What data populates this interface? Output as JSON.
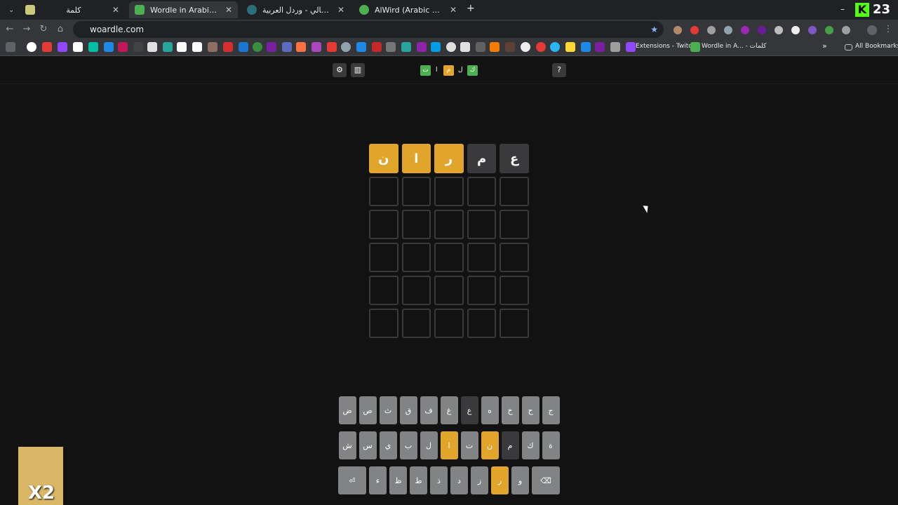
{
  "browser": {
    "tabs": [
      {
        "title": "كلمة",
        "active": false
      },
      {
        "title": "Wordle in Arabic - كلمات",
        "active": true
      },
      {
        "title": "كلمالي - وردل العربية - naly.com",
        "active": false
      },
      {
        "title": "AlWird (Arabic Wordle) - الورد",
        "active": false
      }
    ],
    "new_tab": "+",
    "url": "woardle.com",
    "bookmarks": {
      "extensions_twitch": "Extensions - Twitch",
      "wordle_in_a": "Wordle in A... - كلمات",
      "all_bookmarks": "All Bookmarks"
    },
    "window": {
      "minimize": "–",
      "counter": "23"
    }
  },
  "game": {
    "header": {
      "settings_icon": "gear-icon",
      "stats_icon": "bar-chart-icon",
      "help_label": "?",
      "logo": [
        {
          "char": "ت",
          "state": "correct",
          "color": "#4caf50"
        },
        {
          "char": "ا",
          "state": "plain"
        },
        {
          "char": "م",
          "state": "present",
          "color": "#e2a52b"
        },
        {
          "char": "ل",
          "state": "plain"
        },
        {
          "char": "ك",
          "state": "correct",
          "color": "#4caf50"
        }
      ]
    },
    "board": {
      "rows": [
        [
          {
            "letter": "ن",
            "state": "present"
          },
          {
            "letter": "ا",
            "state": "present"
          },
          {
            "letter": "ر",
            "state": "present"
          },
          {
            "letter": "م",
            "state": "absent"
          },
          {
            "letter": "ع",
            "state": "absent"
          }
        ],
        [
          {
            "letter": "",
            "state": "empty"
          },
          {
            "letter": "",
            "state": "empty"
          },
          {
            "letter": "",
            "state": "empty"
          },
          {
            "letter": "",
            "state": "empty"
          },
          {
            "letter": "",
            "state": "empty"
          }
        ],
        [
          {
            "letter": "",
            "state": "empty"
          },
          {
            "letter": "",
            "state": "empty"
          },
          {
            "letter": "",
            "state": "empty"
          },
          {
            "letter": "",
            "state": "empty"
          },
          {
            "letter": "",
            "state": "empty"
          }
        ],
        [
          {
            "letter": "",
            "state": "empty"
          },
          {
            "letter": "",
            "state": "empty"
          },
          {
            "letter": "",
            "state": "empty"
          },
          {
            "letter": "",
            "state": "empty"
          },
          {
            "letter": "",
            "state": "empty"
          }
        ],
        [
          {
            "letter": "",
            "state": "empty"
          },
          {
            "letter": "",
            "state": "empty"
          },
          {
            "letter": "",
            "state": "empty"
          },
          {
            "letter": "",
            "state": "empty"
          },
          {
            "letter": "",
            "state": "empty"
          }
        ],
        [
          {
            "letter": "",
            "state": "empty"
          },
          {
            "letter": "",
            "state": "empty"
          },
          {
            "letter": "",
            "state": "empty"
          },
          {
            "letter": "",
            "state": "empty"
          },
          {
            "letter": "",
            "state": "empty"
          }
        ]
      ]
    },
    "keyboard": {
      "rows": [
        [
          {
            "k": "ض",
            "s": "normal"
          },
          {
            "k": "ص",
            "s": "normal"
          },
          {
            "k": "ث",
            "s": "normal"
          },
          {
            "k": "ق",
            "s": "normal"
          },
          {
            "k": "ف",
            "s": "normal"
          },
          {
            "k": "غ",
            "s": "normal"
          },
          {
            "k": "ع",
            "s": "absent"
          },
          {
            "k": "ه",
            "s": "normal"
          },
          {
            "k": "خ",
            "s": "normal"
          },
          {
            "k": "ح",
            "s": "normal"
          },
          {
            "k": "ج",
            "s": "normal"
          }
        ],
        [
          {
            "k": "ش",
            "s": "normal"
          },
          {
            "k": "س",
            "s": "normal"
          },
          {
            "k": "ي",
            "s": "normal"
          },
          {
            "k": "ب",
            "s": "normal"
          },
          {
            "k": "ل",
            "s": "normal"
          },
          {
            "k": "ا",
            "s": "present"
          },
          {
            "k": "ت",
            "s": "normal"
          },
          {
            "k": "ن",
            "s": "present"
          },
          {
            "k": "م",
            "s": "absent"
          },
          {
            "k": "ك",
            "s": "normal"
          },
          {
            "k": "ة",
            "s": "normal"
          }
        ],
        [
          {
            "k": "⏎",
            "s": "normal",
            "wide": true
          },
          {
            "k": "ء",
            "s": "normal"
          },
          {
            "k": "ظ",
            "s": "normal"
          },
          {
            "k": "ط",
            "s": "normal"
          },
          {
            "k": "ذ",
            "s": "normal"
          },
          {
            "k": "د",
            "s": "normal"
          },
          {
            "k": "ز",
            "s": "normal"
          },
          {
            "k": "ر",
            "s": "present"
          },
          {
            "k": "و",
            "s": "normal"
          },
          {
            "k": "⌫",
            "s": "normal",
            "wide": true
          }
        ]
      ]
    }
  },
  "overlay": {
    "text": "X2"
  }
}
